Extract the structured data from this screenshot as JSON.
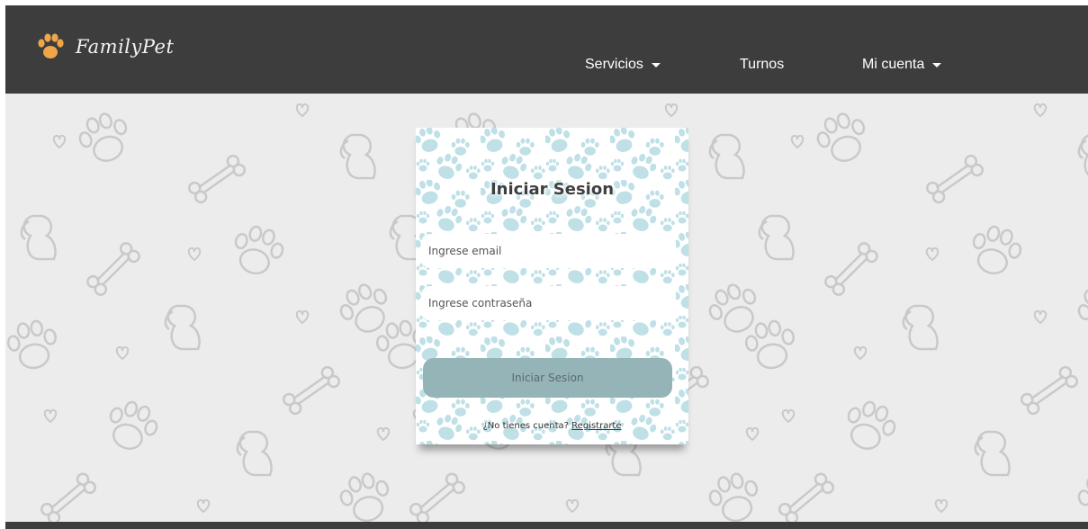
{
  "brand": {
    "name": "FamilyPet",
    "icon": "paw-icon",
    "icon_color": "#f0a54a"
  },
  "nav": {
    "items": [
      {
        "label": "Servicios",
        "has_dropdown": true
      },
      {
        "label": "Turnos",
        "has_dropdown": false
      },
      {
        "label": "Mi cuenta",
        "has_dropdown": true
      }
    ]
  },
  "login": {
    "title": "Iniciar Sesion",
    "email_placeholder": "Ingrese email",
    "password_placeholder": "Ingrese contraseña",
    "submit_label": "Iniciar Sesion",
    "register_prompt": "¿No tienes cuenta?",
    "register_link": "Registrarte"
  },
  "colors": {
    "navbar": "#3d3d3d",
    "background": "#ececec",
    "pattern_stroke": "#c9c9c9",
    "card_pattern": "#bfe0e6",
    "button": "#95b4b7"
  }
}
